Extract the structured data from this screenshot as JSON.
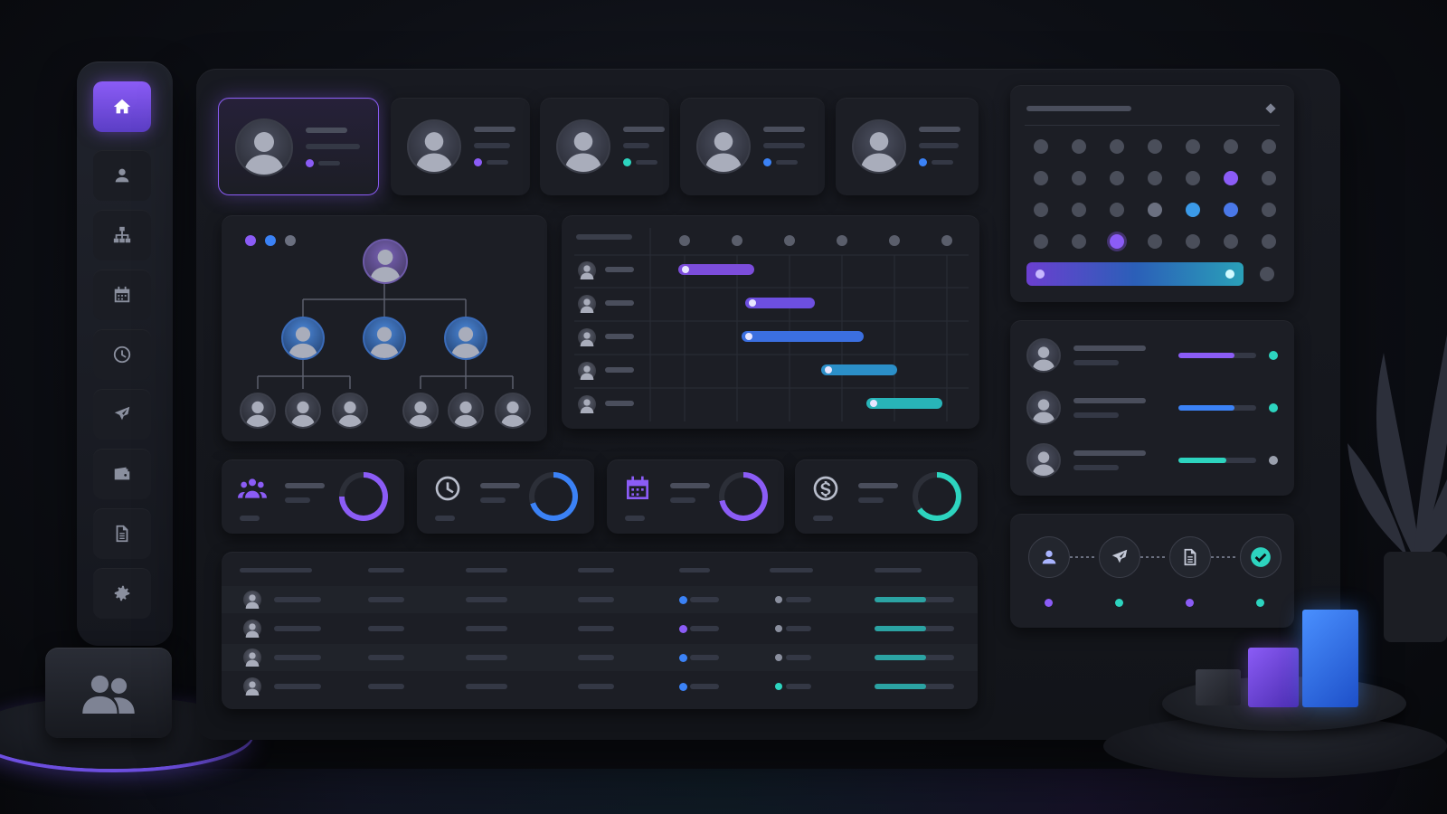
{
  "sidebar": {
    "items": [
      {
        "icon": "home-icon",
        "active": true
      },
      {
        "icon": "user-icon",
        "active": false
      },
      {
        "icon": "org-chart-icon",
        "active": false
      },
      {
        "icon": "calendar-icon",
        "active": false
      },
      {
        "icon": "clock-icon",
        "active": false
      },
      {
        "icon": "airplane-icon",
        "active": false
      },
      {
        "icon": "wallet-icon",
        "active": false
      },
      {
        "icon": "document-icon",
        "active": false
      },
      {
        "icon": "gear-icon",
        "active": false
      }
    ]
  },
  "profiles": [
    {
      "status_color": "#8b5cf6",
      "selected": true
    },
    {
      "status_color": "#8b5cf6",
      "selected": false
    },
    {
      "status_color": "#2dd4bf",
      "selected": false
    },
    {
      "status_color": "#3b82f6",
      "selected": false
    },
    {
      "status_color": "#3b82f6",
      "selected": false
    }
  ],
  "org_chart": {
    "dots": [
      "#8b5cf6",
      "#3b82f6",
      "#6b7080"
    ]
  },
  "gantt": {
    "rows": [
      {
        "start": 0.05,
        "end": 0.3,
        "color": "#7c4ddb"
      },
      {
        "start": 0.27,
        "end": 0.5,
        "color": "#6d4fe0"
      },
      {
        "start": 0.26,
        "end": 0.66,
        "color": "#3b6fe0"
      },
      {
        "start": 0.52,
        "end": 0.77,
        "color": "#2b8fc8"
      },
      {
        "start": 0.67,
        "end": 0.92,
        "color": "#28b4b8"
      }
    ]
  },
  "stats": [
    {
      "icon": "team-icon",
      "progress": 0.75,
      "color": "#8b5cf6"
    },
    {
      "icon": "clock-icon",
      "progress": 0.7,
      "color": "#3b82f6"
    },
    {
      "icon": "calendar-icon",
      "progress": 0.72,
      "color": "#8b5cf6"
    },
    {
      "icon": "dollar-icon",
      "progress": 0.65,
      "color": "#2dd4bf"
    }
  ],
  "table": {
    "rows": [
      {
        "status_color": "#3b82f6",
        "indicator_color": "#8a8f9e",
        "progress": 0.65
      },
      {
        "status_color": "#8b5cf6",
        "indicator_color": "#8a8f9e",
        "progress": 0.65
      },
      {
        "status_color": "#3b82f6",
        "indicator_color": "#8a8f9e",
        "progress": 0.65
      },
      {
        "status_color": "#3b82f6",
        "indicator_color": "#2dd4bf",
        "progress": 0.65
      }
    ]
  },
  "calendar": {
    "highlighted": [
      {
        "row": 1,
        "col": 5,
        "color": "#8b5cf6"
      },
      {
        "row": 2,
        "col": 3,
        "color": "#6b7080"
      },
      {
        "row": 2,
        "col": 4,
        "color": "#3b9ae8"
      },
      {
        "row": 2,
        "col": 5,
        "color": "#4a78e8"
      },
      {
        "row": 3,
        "col": 2,
        "color": "#8b5cf6"
      }
    ]
  },
  "team_progress": [
    {
      "progress": 0.72,
      "color": "#8b5cf6",
      "status_color": "#2dd4bf"
    },
    {
      "progress": 0.72,
      "color": "#3b82f6",
      "status_color": "#2dd4bf"
    },
    {
      "progress": 0.62,
      "color": "#2dd4bf",
      "status_color": "#9aa0ad"
    }
  ],
  "workflow": {
    "steps": [
      {
        "icon": "user-icon",
        "dot_color": "#8b5cf6"
      },
      {
        "icon": "airplane-icon",
        "dot_color": "#2dd4bf"
      },
      {
        "icon": "document-icon",
        "dot_color": "#8b5cf6"
      },
      {
        "icon": "check-icon",
        "dot_color": "#2dd4bf"
      }
    ]
  }
}
